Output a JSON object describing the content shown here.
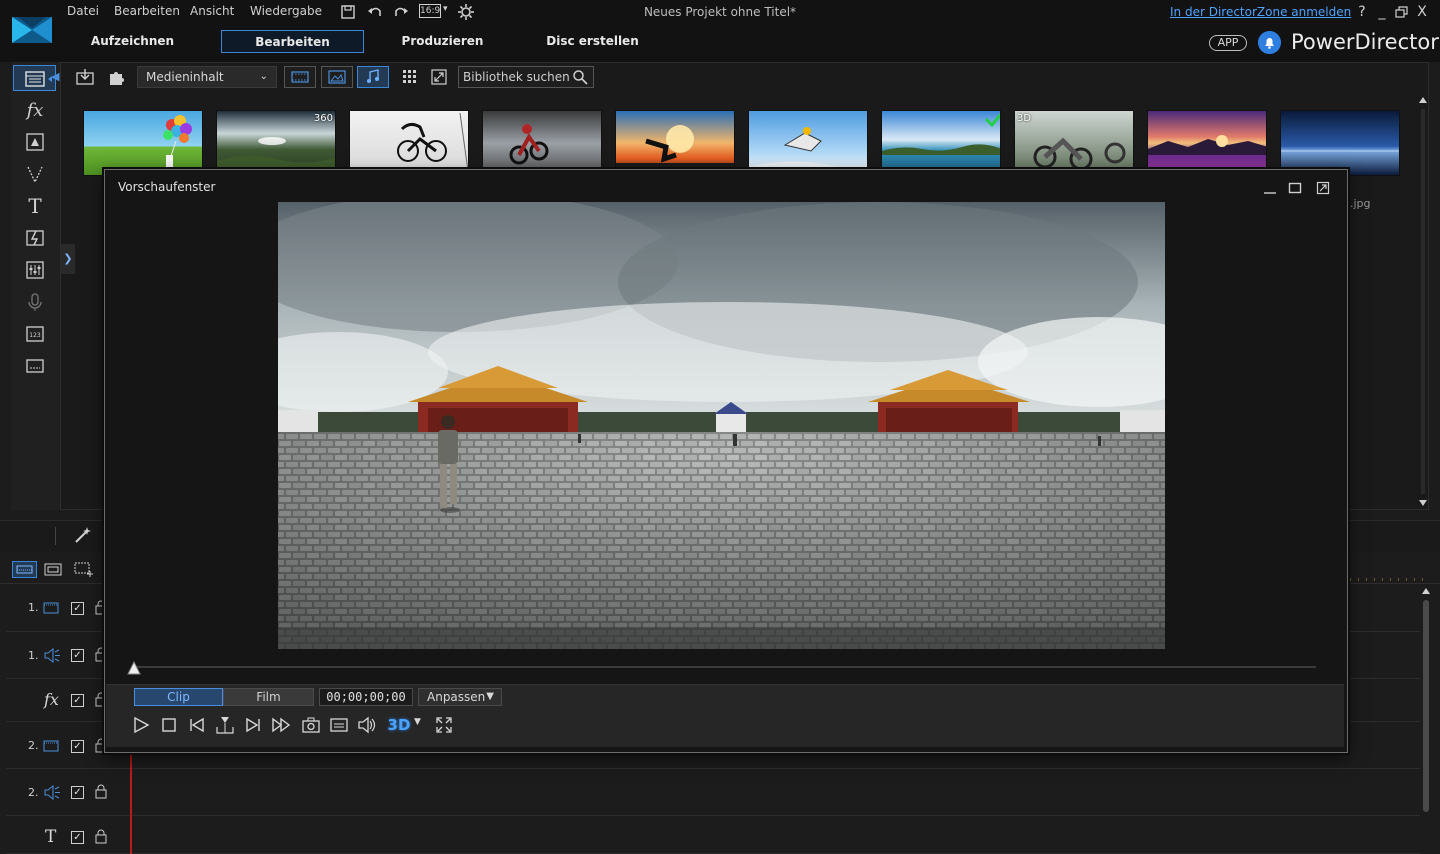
{
  "menu": {
    "file": "Datei",
    "edit": "Bearbeiten",
    "view": "Ansicht",
    "playback": "Wiedergabe",
    "aspect": "16:9"
  },
  "window": {
    "title": "Neues Projekt ohne Titel*",
    "login_link": "In der DirectorZone anmelden",
    "help": "?",
    "minimize": "_",
    "close": "X"
  },
  "main_tabs": [
    {
      "label": "Aufzeichnen"
    },
    {
      "label": "Bearbeiten"
    },
    {
      "label": "Produzieren"
    },
    {
      "label": "Disc erstellen"
    }
  ],
  "brand": {
    "app_badge": "APP",
    "name": "PowerDirector"
  },
  "library": {
    "media_select": "Medieninhalt",
    "search_placeholder": "Bibliothek suchen",
    "thumbnails": [
      {
        "name": "balloons"
      },
      {
        "name": "island",
        "badge": "360"
      },
      {
        "name": "bmx"
      },
      {
        "name": "motocross"
      },
      {
        "name": "skateboard"
      },
      {
        "name": "skydiving"
      },
      {
        "name": "beach",
        "checked": true
      },
      {
        "name": "motorcycles",
        "badge": "3D"
      },
      {
        "name": "flowers"
      },
      {
        "name": "sunset"
      }
    ],
    "partial_label": ".jpg"
  },
  "preview": {
    "title": "Vorschaufenster",
    "mode_clip": "Clip",
    "mode_film": "Film",
    "timecode": "00;00;00;00",
    "fit": "Anpassen",
    "stereo_label": "3D"
  },
  "tracks": [
    {
      "num": "1.",
      "type": "video"
    },
    {
      "num": "1.",
      "type": "audio"
    },
    {
      "num": "",
      "type": "fx"
    },
    {
      "num": "2.",
      "type": "video"
    },
    {
      "num": "2.",
      "type": "audio"
    },
    {
      "num": "",
      "type": "title"
    }
  ],
  "colors": {
    "accent": "#3a86d8",
    "playhead": "#b81b1b",
    "background": "#1c1c1c"
  }
}
